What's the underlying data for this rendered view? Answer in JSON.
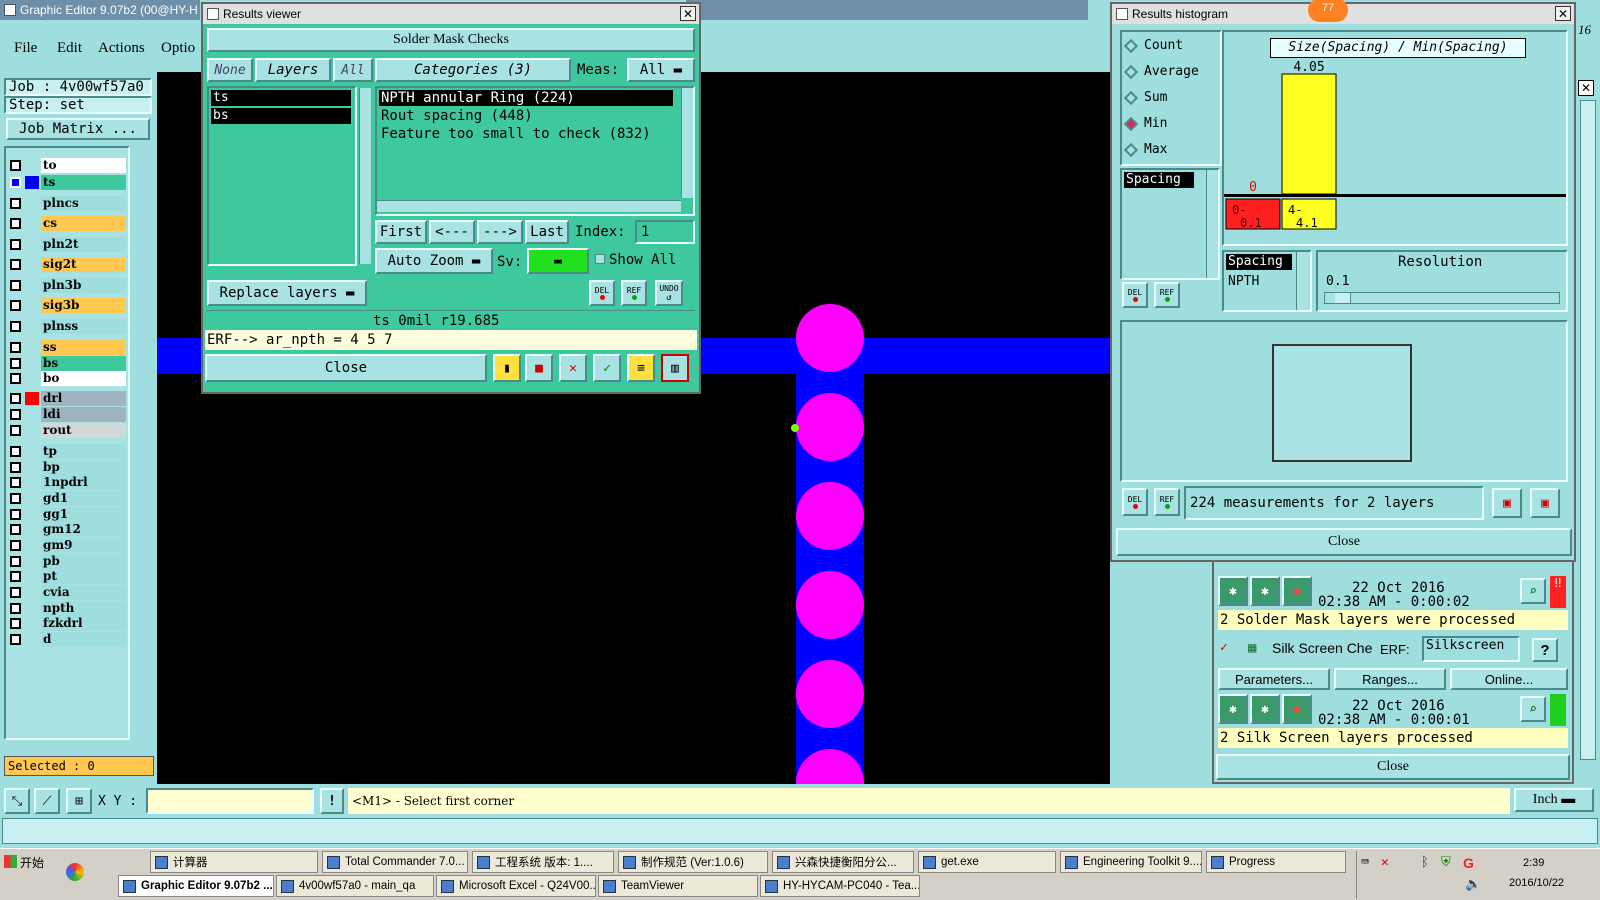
{
  "app": {
    "main_title": "Graphic Editor 9.07b2 (00@HY-H",
    "menu": [
      "File",
      "Edit",
      "Actions",
      "Optio"
    ],
    "job_label": "Job : 4v00wf57a0",
    "step_label": "Step: set",
    "job_matrix": "Job Matrix ...",
    "selected": "Selected : 0",
    "xy_label": "X Y :",
    "status_prompt": "<M1> - Select first corner",
    "units": "Inch",
    "right_edge_number": "16"
  },
  "layers": [
    {
      "name": "to",
      "color": "#ffffff"
    },
    {
      "name": "ts",
      "color": "#3ec89e"
    },
    {
      "name": "plncs",
      "color": "#9fdede"
    },
    {
      "name": "cs",
      "color": "#ffc850"
    },
    {
      "name": "pln2t",
      "color": "#9fdede"
    },
    {
      "name": "sig2t",
      "color": "#ffc850"
    },
    {
      "name": "pln3b",
      "color": "#9fdede"
    },
    {
      "name": "sig3b",
      "color": "#ffc850"
    },
    {
      "name": "plnss",
      "color": "#9fdede"
    },
    {
      "name": "ss",
      "color": "#ffc850"
    },
    {
      "name": "bs",
      "color": "#3ec89e"
    },
    {
      "name": "bo",
      "color": "#ffffff"
    },
    {
      "name": "drl",
      "color": "#a0b4c0"
    },
    {
      "name": "ldi",
      "color": "#a0b4c0"
    },
    {
      "name": "rout",
      "color": "#d0d8d8"
    },
    {
      "name": "tp",
      "color": "#9fdede"
    },
    {
      "name": "bp",
      "color": "#9fdede"
    },
    {
      "name": "1npdrl",
      "color": "#9fdede"
    },
    {
      "name": "gd1",
      "color": "#9fdede"
    },
    {
      "name": "gg1",
      "color": "#9fdede"
    },
    {
      "name": "gm12",
      "color": "#9fdede"
    },
    {
      "name": "gm9",
      "color": "#9fdede"
    },
    {
      "name": "pb",
      "color": "#9fdede"
    },
    {
      "name": "pt",
      "color": "#9fdede"
    },
    {
      "name": "cvia",
      "color": "#9fdede"
    },
    {
      "name": "npth",
      "color": "#9fdede"
    },
    {
      "name": "fzkdrl",
      "color": "#9fdede"
    },
    {
      "name": "d",
      "color": "#9fdede"
    }
  ],
  "results_viewer": {
    "title": "Results viewer",
    "header": "Solder Mask Checks",
    "none_btn": "None",
    "layers_btn": "Layers",
    "all_btn": "All",
    "categories_btn": "Categories (3)",
    "meas_label": "Meas:",
    "meas_value": "All",
    "layer_items": [
      "ts",
      "bs"
    ],
    "categories": [
      "NPTH annular Ring (224)",
      "Rout spacing (448)",
      "Feature too small to check (832)"
    ],
    "first": "First",
    "prev": "<---",
    "next": "--->",
    "last": "Last",
    "index_label": "Index:",
    "index_value": "1",
    "auto_zoom": "Auto Zoom",
    "sv_label": "Sv:",
    "show_all": "Show All",
    "replace_layers": "Replace layers",
    "del": "DEL",
    "ref": "REF",
    "undo": "UNDO",
    "info_line": "ts 0mil   r19.685",
    "erf_line": "ERF--> ar_npth = 4 5 7",
    "close": "Close"
  },
  "histogram": {
    "title": "Results histogram",
    "badge": "77",
    "options": [
      "Count",
      "Average",
      "Sum",
      "Min",
      "Max"
    ],
    "selected_option": "Min",
    "list_item": "Spacing",
    "chart_title": "Size(Spacing) / Min(Spacing)",
    "spacing_label": "Spacing",
    "npth_label": "NPTH",
    "resolution_label": "Resolution",
    "resolution_value": "0.1",
    "measurements": "224 measurements for 2 layers",
    "close": "Close"
  },
  "chart_data": {
    "type": "bar",
    "title": "Size(Spacing) / Min(Spacing)",
    "categories": [
      "0-0.1",
      "4-4.1"
    ],
    "values": [
      0,
      4.05
    ],
    "data_labels": [
      "0",
      "4.05"
    ],
    "colors": [
      "#ff2020",
      "#ffff20"
    ],
    "ylim": [
      0,
      4.05
    ],
    "grid": false
  },
  "checklist": {
    "row1": {
      "date": "22 Oct 2016",
      "time": "02:38 AM - 0:00:02",
      "msg": "2 Solder Mask layers were processed"
    },
    "silk_label": "Silk Screen Che",
    "erf_label": "ERF:",
    "erf_value": "Silkscreen",
    "help": "?",
    "parameters": "Parameters...",
    "ranges": "Ranges...",
    "online": "Online...",
    "row2": {
      "date": "22 Oct 2016",
      "time": "02:38 AM - 0:00:01",
      "msg": "2 Silk Screen layers processed"
    },
    "close": "Close"
  },
  "taskbar": {
    "start": "开始",
    "top": [
      "计算器",
      "Total Commander 7.0...",
      "工程系统  版本: 1....",
      "制作规范 (Ver:1.0.6)",
      "兴森快捷衡阳分公...",
      "get.exe",
      "Engineering Toolkit 9....",
      "Progress"
    ],
    "bottom": [
      "Graphic Editor 9.07b2 ...",
      "4v00wf57a0 - main_qa",
      "Microsoft Excel - Q24V00...",
      "TeamViewer",
      "HY-HYCAM-PC040 - Tea..."
    ],
    "time": "2:39",
    "date": "2016/10/22"
  },
  "colors": {
    "pad": "#ff00ff",
    "trace": "#0000ff",
    "canvas": "#000000",
    "panel": "#9fdede"
  }
}
